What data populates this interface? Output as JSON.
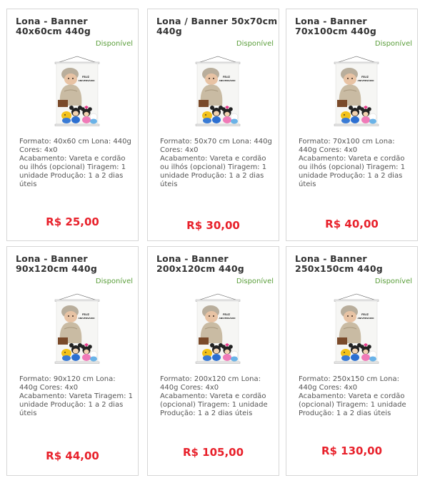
{
  "products": [
    {
      "title": "Lona - Banner 40x60cm 440g",
      "status": "Disponível",
      "description": "Formato: 40x60 cm  Lona: 440g Cores: 4x0\nAcabamento: Vareta e cordão ou ilhós (opcional) Tiragem: 1 unidade Produção: 1  a 2 dias úteis",
      "price": "R$ 25,00"
    },
    {
      "title": "Lona / Banner 50x70cm 440g",
      "status": "Disponível",
      "description": "Formato: 50x70 cm  Lona: 440g Cores:  4x0\nAcabamento: Vareta e cordão ou ilhós (opcional) Tiragem: 1 unidade Produção: 1 a 2 dias úteis",
      "price": "R$ 30,00"
    },
    {
      "title": "Lona - Banner 70x100cm 440g",
      "status": "Disponível",
      "description": "Formato: 70x100 cm  Lona: 440g Cores:  4x0\nAcabamento: Vareta e cordão ou ilhós (opcional) Tiragem: 1 unidade Produção: 1 a 2 dias úteis",
      "price": "R$ 40,00"
    },
    {
      "title": "Lona - Banner 90x120cm 440g",
      "status": "Disponível",
      "description": "Formato: 90x120 cm  Lona: 440g Cores:  4x0\nAcabamento: Vareta  Tiragem: 1 unidade Produção: 1 a 2 dias úteis",
      "price": "R$ 44,00"
    },
    {
      "title": "Lona - Banner 200x120cm 440g",
      "status": "Disponível",
      "description": "Formato: 200x120 cm  Lona: 440g Cores:  4x0\nAcabamento: Vareta e cordão (opcional) Tiragem: 1 unidade Produção: 1 a 2 dias úteis",
      "price": "R$ 105,00"
    },
    {
      "title": "Lona - Banner 250x150cm 440g",
      "status": "Disponível",
      "description": "Formato: 250x150 cm  Lona: 440g Cores:  4x0\nAcabamento: Vareta e cordão (opcional) Tiragem: 1 unidade Produção: 1 a 2 dias úteis",
      "price": "R$ 130,00"
    }
  ],
  "banner_image": {
    "text_line1": "FELIZ",
    "text_line2": "ANIVERSÁRIO"
  }
}
